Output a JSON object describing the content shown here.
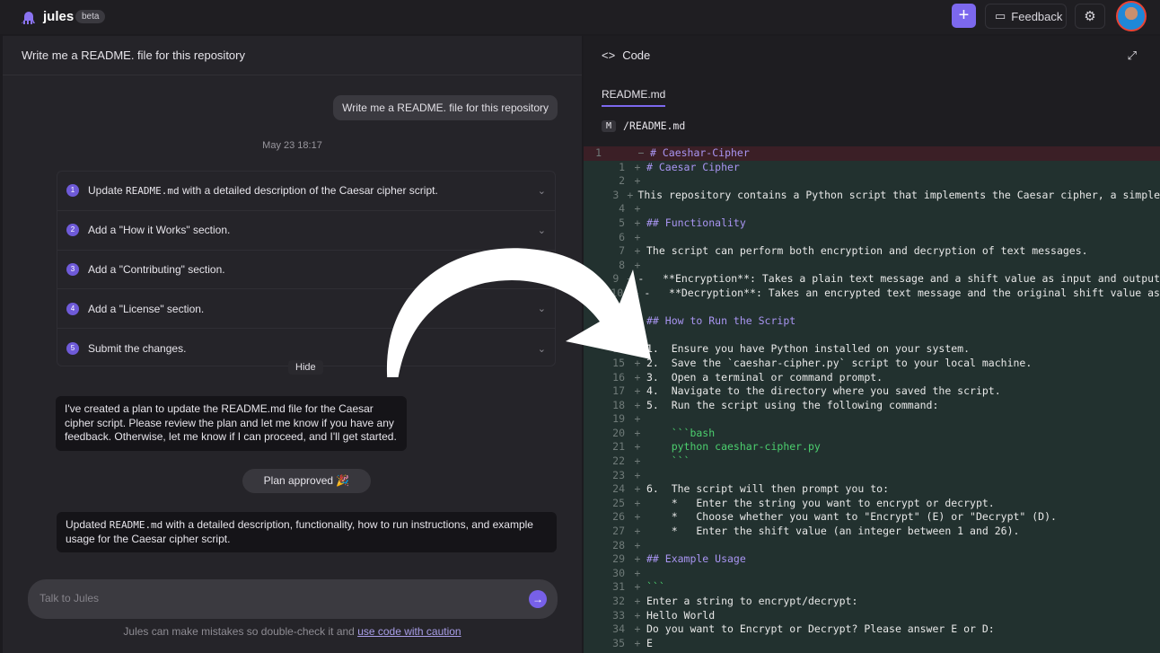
{
  "header": {
    "brand": "jules",
    "badge": "beta",
    "new_label": "+",
    "feedback_label": "Feedback"
  },
  "chat": {
    "title": "Write me a README. file for this repository",
    "user_message": "Write me a README. file for this repository",
    "timestamp": "May 23 18:17",
    "plan": [
      {
        "n": "1",
        "pre": "Update ",
        "code": "README.md",
        "post": " with a detailed description of the Caesar cipher script."
      },
      {
        "n": "2",
        "pre": "Add a \"How it Works\" section.",
        "code": "",
        "post": ""
      },
      {
        "n": "3",
        "pre": "Add a \"Contributing\" section.",
        "code": "",
        "post": ""
      },
      {
        "n": "4",
        "pre": "Add a \"License\" section.",
        "code": "",
        "post": ""
      },
      {
        "n": "5",
        "pre": "Submit the changes.",
        "code": "",
        "post": ""
      }
    ],
    "hide_label": "Hide",
    "agent_message": "I've created a plan to update the README.md file for the Caesar cipher script. Please review the plan and let me know if you have any feedback. Otherwise, let me know if I can proceed, and I'll get started.",
    "approved_label": "Plan approved 🎉",
    "update_pre": "Updated ",
    "update_code": "README.md",
    "update_post": " with a detailed description, functionality, how to run instructions, and example usage for the Caesar cipher script.",
    "input_placeholder": "Talk to Jules",
    "disclaimer": "Jules can make mistakes so double-check it and ",
    "disclaimer_link": "use code with caution"
  },
  "code_panel": {
    "title": "Code",
    "file_tab": "README.md",
    "badge": "M",
    "path": "/README.md",
    "removed": {
      "n": "1",
      "text": "# Caeshar-Cipher"
    },
    "lines": [
      {
        "n": "1",
        "t": "# Caesar Cipher",
        "c": "h"
      },
      {
        "n": "2",
        "t": ""
      },
      {
        "n": "3",
        "t": "This repository contains a Python script that implements the Caesar cipher, a simple"
      },
      {
        "n": "4",
        "t": ""
      },
      {
        "n": "5",
        "t": "## Functionality",
        "c": "h"
      },
      {
        "n": "6",
        "t": ""
      },
      {
        "n": "7",
        "t": "The script can perform both encryption and decryption of text messages."
      },
      {
        "n": "8",
        "t": ""
      },
      {
        "n": "9",
        "t": "-   **Encryption**: Takes a plain text message and a shift value as input and output"
      },
      {
        "n": "10",
        "t": "-   **Decryption**: Takes an encrypted text message and the original shift value as"
      },
      {
        "n": "11",
        "t": ""
      },
      {
        "n": "12",
        "t": "## How to Run the Script",
        "c": "h"
      },
      {
        "n": "13",
        "t": ""
      },
      {
        "n": "14",
        "t": "1.  Ensure you have Python installed on your system."
      },
      {
        "n": "15",
        "t": "2.  Save the `caeshar-cipher.py` script to your local machine."
      },
      {
        "n": "16",
        "t": "3.  Open a terminal or command prompt."
      },
      {
        "n": "17",
        "t": "4.  Navigate to the directory where you saved the script."
      },
      {
        "n": "18",
        "t": "5.  Run the script using the following command:"
      },
      {
        "n": "19",
        "t": ""
      },
      {
        "n": "20",
        "t": "    ```bash",
        "c": "g"
      },
      {
        "n": "21",
        "t": "    python caeshar-cipher.py",
        "c": "g"
      },
      {
        "n": "22",
        "t": "    ```",
        "c": "g"
      },
      {
        "n": "23",
        "t": ""
      },
      {
        "n": "24",
        "t": "6.  The script will then prompt you to:"
      },
      {
        "n": "25",
        "t": "    *   Enter the string you want to encrypt or decrypt."
      },
      {
        "n": "26",
        "t": "    *   Choose whether you want to \"Encrypt\" (E) or \"Decrypt\" (D)."
      },
      {
        "n": "27",
        "t": "    *   Enter the shift value (an integer between 1 and 26)."
      },
      {
        "n": "28",
        "t": ""
      },
      {
        "n": "29",
        "t": "## Example Usage",
        "c": "h"
      },
      {
        "n": "30",
        "t": ""
      },
      {
        "n": "31",
        "t": "```",
        "c": "g"
      },
      {
        "n": "32",
        "t": "Enter a string to encrypt/decrypt:"
      },
      {
        "n": "33",
        "t": "Hello World"
      },
      {
        "n": "34",
        "t": "Do you want to Encrypt or Decrypt? Please answer E or D:"
      },
      {
        "n": "35",
        "t": "E"
      }
    ]
  },
  "colors": {
    "accent": "#7c68ee",
    "added_bg": "#22312f",
    "removed_bg": "#3b1f26"
  }
}
